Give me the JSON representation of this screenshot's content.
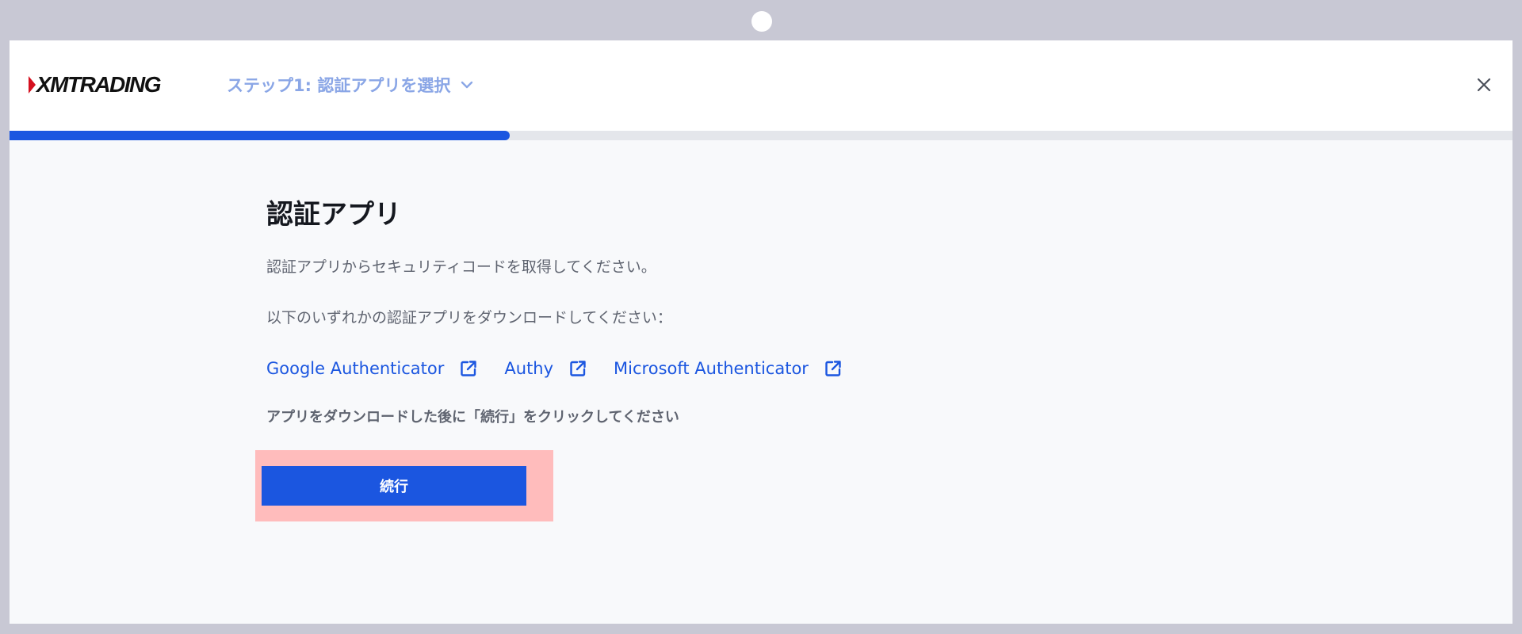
{
  "header": {
    "logo_text": "XMTRADING",
    "step_label": "ステップ1: 認証アプリを選択"
  },
  "progress": {
    "fraction": 0.333
  },
  "main": {
    "title": "認証アプリ",
    "description_1": "認証アプリからセキュリティコードを取得してください。",
    "description_2": "以下のいずれかの認証アプリをダウンロードしてください：",
    "links": [
      {
        "label": "Google Authenticator"
      },
      {
        "label": "Authy"
      },
      {
        "label": "Microsoft Authenticator"
      }
    ],
    "instruction": "アプリをダウンロードした後に「続行」をクリックしてください",
    "continue_label": "続行"
  },
  "colors": {
    "accent": "#1b56e0",
    "step_label": "#8aa6e6",
    "highlight": "#ffbcbc"
  },
  "icons": {
    "step_dropdown": "chevron-down-icon",
    "close": "close-icon",
    "link": "external-link-icon"
  }
}
